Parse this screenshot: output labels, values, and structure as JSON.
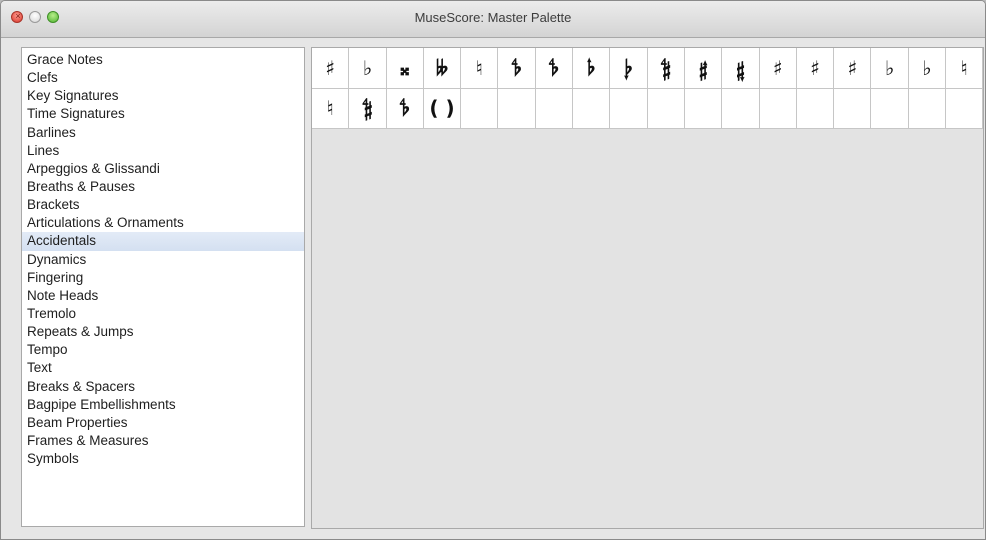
{
  "window": {
    "title": "MuseScore: Master Palette",
    "close_glyph": "×"
  },
  "categories": [
    "Grace Notes",
    "Clefs",
    "Key Signatures",
    "Time Signatures",
    "Barlines",
    "Lines",
    "Arpeggios & Glissandi",
    "Breaths & Pauses",
    "Brackets",
    "Articulations & Ornaments",
    "Accidentals",
    "Dynamics",
    "Fingering",
    "Note Heads",
    "Tremolo",
    "Repeats & Jumps",
    "Tempo",
    "Text",
    "Breaks & Spacers",
    "Bagpipe Embellishments",
    "Beam Properties",
    "Frames & Measures",
    "Symbols"
  ],
  "selected_category": "Accidentals",
  "palette": {
    "columns": 18,
    "cells": [
      {
        "glyph": "♯",
        "icon": "sharp-icon"
      },
      {
        "glyph": "♭",
        "icon": "flat-icon"
      },
      {
        "glyph": "𝄪",
        "icon": "double-sharp-icon"
      },
      {
        "glyph": "𝄫",
        "icon": "double-flat-icon"
      },
      {
        "glyph": "♮",
        "icon": "natural-icon"
      },
      {
        "glyph": "𝄳",
        "icon": "flat-slash-icon"
      },
      {
        "glyph": "𝄳",
        "icon": "flat-slash2-icon"
      },
      {
        "glyph": "𝄬",
        "icon": "flat-arrow-up-icon"
      },
      {
        "glyph": "𝄭",
        "icon": "flat-arrow-down-icon"
      },
      {
        "glyph": "𝄲",
        "icon": "quarter-sharp-icon"
      },
      {
        "glyph": "𝄰",
        "icon": "sharp-arrow-up-icon"
      },
      {
        "glyph": "𝄱",
        "icon": "sharp-arrow-down-icon"
      },
      {
        "glyph": "♯",
        "icon": "sharp-slash-icon"
      },
      {
        "glyph": "♯",
        "icon": "sharp-slash2-icon"
      },
      {
        "glyph": "♯",
        "icon": "sharp-slash3-icon"
      },
      {
        "glyph": "♭",
        "icon": "flat-arrow-icon"
      },
      {
        "glyph": "♭",
        "icon": "flat-arrow2-icon"
      },
      {
        "glyph": "♮",
        "icon": "natural-arrow-up-icon"
      },
      {
        "glyph": "♮",
        "icon": "natural-arrow-down-icon"
      },
      {
        "glyph": "𝄲",
        "icon": "sori-icon"
      },
      {
        "glyph": "𝄳",
        "icon": "koron-icon"
      },
      {
        "glyph": "( )",
        "icon": "parentheses-icon"
      },
      {
        "glyph": "",
        "icon": ""
      },
      {
        "glyph": "",
        "icon": ""
      },
      {
        "glyph": "",
        "icon": ""
      },
      {
        "glyph": "",
        "icon": ""
      },
      {
        "glyph": "",
        "icon": ""
      },
      {
        "glyph": "",
        "icon": ""
      },
      {
        "glyph": "",
        "icon": ""
      },
      {
        "glyph": "",
        "icon": ""
      },
      {
        "glyph": "",
        "icon": ""
      },
      {
        "glyph": "",
        "icon": ""
      },
      {
        "glyph": "",
        "icon": ""
      },
      {
        "glyph": "",
        "icon": ""
      },
      {
        "glyph": "",
        "icon": ""
      },
      {
        "glyph": "",
        "icon": ""
      }
    ]
  }
}
